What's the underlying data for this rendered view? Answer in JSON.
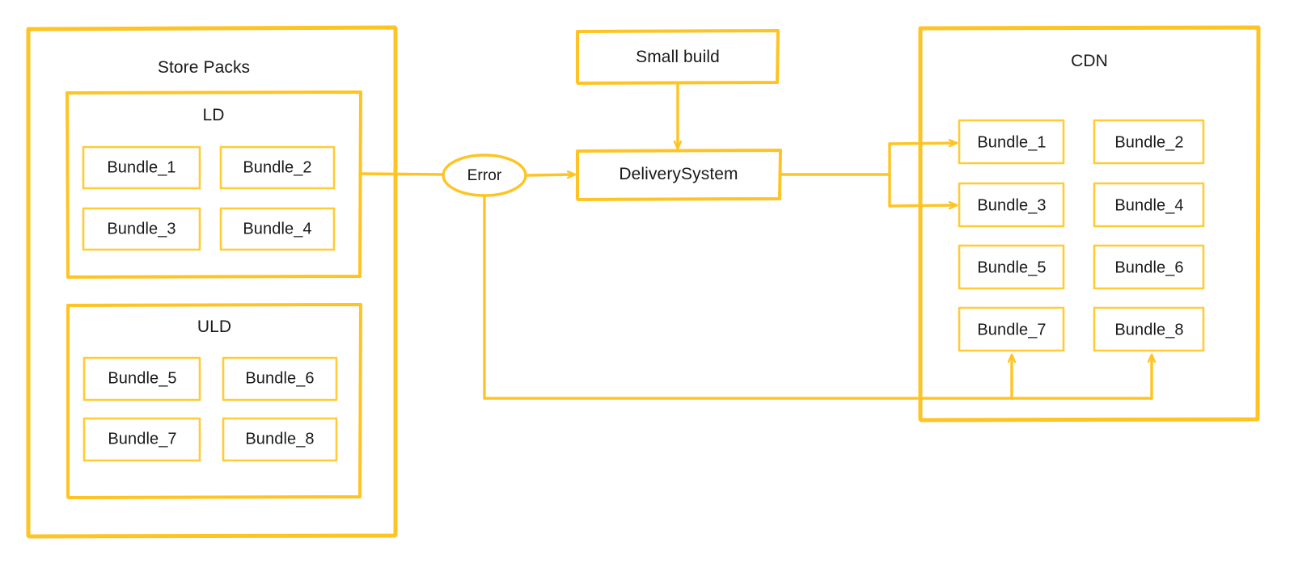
{
  "diagram": {
    "title_text_color": "#1a1a1a",
    "stroke_color": "#FFC423",
    "stroke_color_light": "#FFCC33",
    "background": "#FFFFFF"
  },
  "store_packs": {
    "label": "Store Packs",
    "groups": [
      {
        "label": "LD",
        "bundles": [
          "Bundle_1",
          "Bundle_2",
          "Bundle_3",
          "Bundle_4"
        ]
      },
      {
        "label": "ULD",
        "bundles": [
          "Bundle_5",
          "Bundle_6",
          "Bundle_7",
          "Bundle_8"
        ]
      }
    ]
  },
  "middle": {
    "error_node": "Error",
    "small_build_node": "Small build",
    "delivery_system_node": "DeliverySystem"
  },
  "cdn": {
    "label": "CDN",
    "bundles": [
      "Bundle_1",
      "Bundle_2",
      "Bundle_3",
      "Bundle_4",
      "Bundle_5",
      "Bundle_6",
      "Bundle_7",
      "Bundle_8"
    ]
  }
}
